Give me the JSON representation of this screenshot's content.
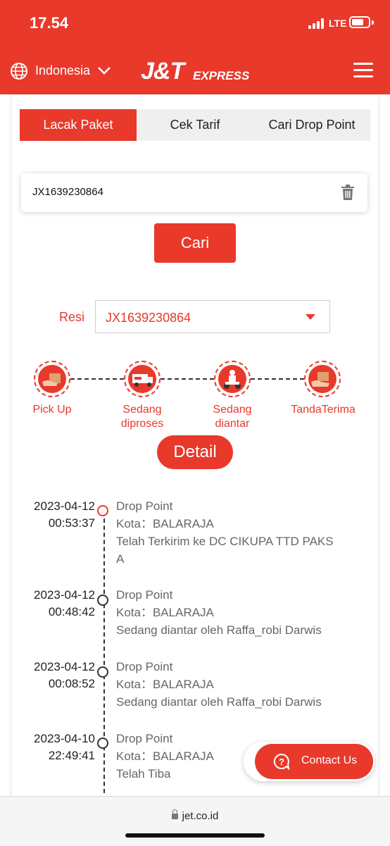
{
  "status": {
    "time": "17.54",
    "network": "LTE"
  },
  "header": {
    "country": "Indonesia",
    "logo_main": "J&T",
    "logo_sub": "EXPRESS"
  },
  "tabs": [
    {
      "label": "Lacak Paket",
      "active": true
    },
    {
      "label": "Cek Tarif",
      "active": false
    },
    {
      "label": "Cari Drop Point",
      "active": false
    }
  ],
  "search": {
    "value": "JX1639230864",
    "button": "Cari"
  },
  "resi": {
    "label": "Resi",
    "selected": "JX1639230864"
  },
  "steps": [
    {
      "label_line1": "Pick Up",
      "label_line2": ""
    },
    {
      "label_line1": "Sedang",
      "label_line2": "diproses"
    },
    {
      "label_line1": "Sedang",
      "label_line2": "diantar"
    },
    {
      "label_line1": "TandaTerima",
      "label_line2": ""
    }
  ],
  "detail_button": "Detail",
  "timeline": [
    {
      "date": "2023-04-12",
      "time": "00:53:37",
      "title": "Drop Point",
      "kota": "Kota：BALARAJA",
      "desc": "Telah Terkirim ke DC CIKUPA TTD PAKS",
      "desc2": "A"
    },
    {
      "date": "2023-04-12",
      "time": "00:48:42",
      "title": "Drop Point",
      "kota": "Kota：BALARAJA",
      "desc": "Sedang diantar oleh Raffa_robi Darwis",
      "desc2": ""
    },
    {
      "date": "2023-04-12",
      "time": "00:08:52",
      "title": "Drop Point",
      "kota": "Kota：BALARAJA",
      "desc": "Sedang diantar oleh Raffa_robi Darwis",
      "desc2": ""
    },
    {
      "date": "2023-04-10",
      "time": "22:49:41",
      "title": "Drop Point",
      "kota": "Kota：BALARAJA",
      "desc": "Telah Tiba",
      "desc2": ""
    }
  ],
  "contact": {
    "label": "Contact Us"
  },
  "browser": {
    "url": "jet.co.id"
  },
  "colors": {
    "brand": "#e8392b"
  }
}
